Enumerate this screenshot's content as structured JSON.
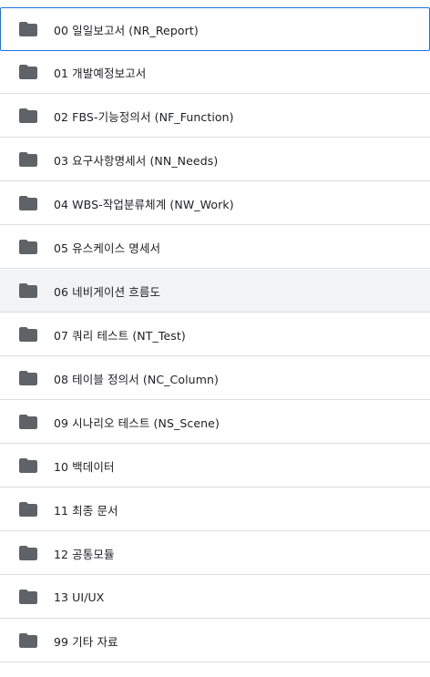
{
  "colors": {
    "folder_icon": "#5f6368",
    "selected_border": "#1a73e8",
    "hover_background": "#f1f3f4",
    "divider": "#dadce0",
    "text": "#202124"
  },
  "folders": [
    {
      "label": "00 일일보고서 (NR_Report)",
      "icon": "folder-icon",
      "state": "selected"
    },
    {
      "label": "01 개발예정보고서",
      "icon": "folder-icon",
      "state": "normal"
    },
    {
      "label": "02 FBS-기능정의서 (NF_Function)",
      "icon": "folder-icon",
      "state": "normal"
    },
    {
      "label": "03 요구사항명세서 (NN_Needs)",
      "icon": "folder-icon",
      "state": "normal"
    },
    {
      "label": "04 WBS-작업분류체계 (NW_Work)",
      "icon": "folder-icon",
      "state": "normal"
    },
    {
      "label": "05 유스케이스 명세서",
      "icon": "folder-icon",
      "state": "normal"
    },
    {
      "label": "06 네비게이션 흐름도",
      "icon": "folder-icon",
      "state": "hovered"
    },
    {
      "label": "07 쿼리 테스트 (NT_Test)",
      "icon": "folder-icon",
      "state": "normal"
    },
    {
      "label": "08 테이블 정의서 (NC_Column)",
      "icon": "folder-icon",
      "state": "normal"
    },
    {
      "label": "09 시나리오 테스트 (NS_Scene)",
      "icon": "folder-icon",
      "state": "normal"
    },
    {
      "label": "10 백데이터",
      "icon": "folder-icon",
      "state": "normal"
    },
    {
      "label": "11 최종 문서",
      "icon": "folder-icon",
      "state": "normal"
    },
    {
      "label": "12 공통모듈",
      "icon": "folder-icon",
      "state": "normal"
    },
    {
      "label": "13 UI/UX",
      "icon": "folder-icon",
      "state": "normal"
    },
    {
      "label": "99 기타 자료",
      "icon": "folder-icon",
      "state": "normal"
    }
  ]
}
